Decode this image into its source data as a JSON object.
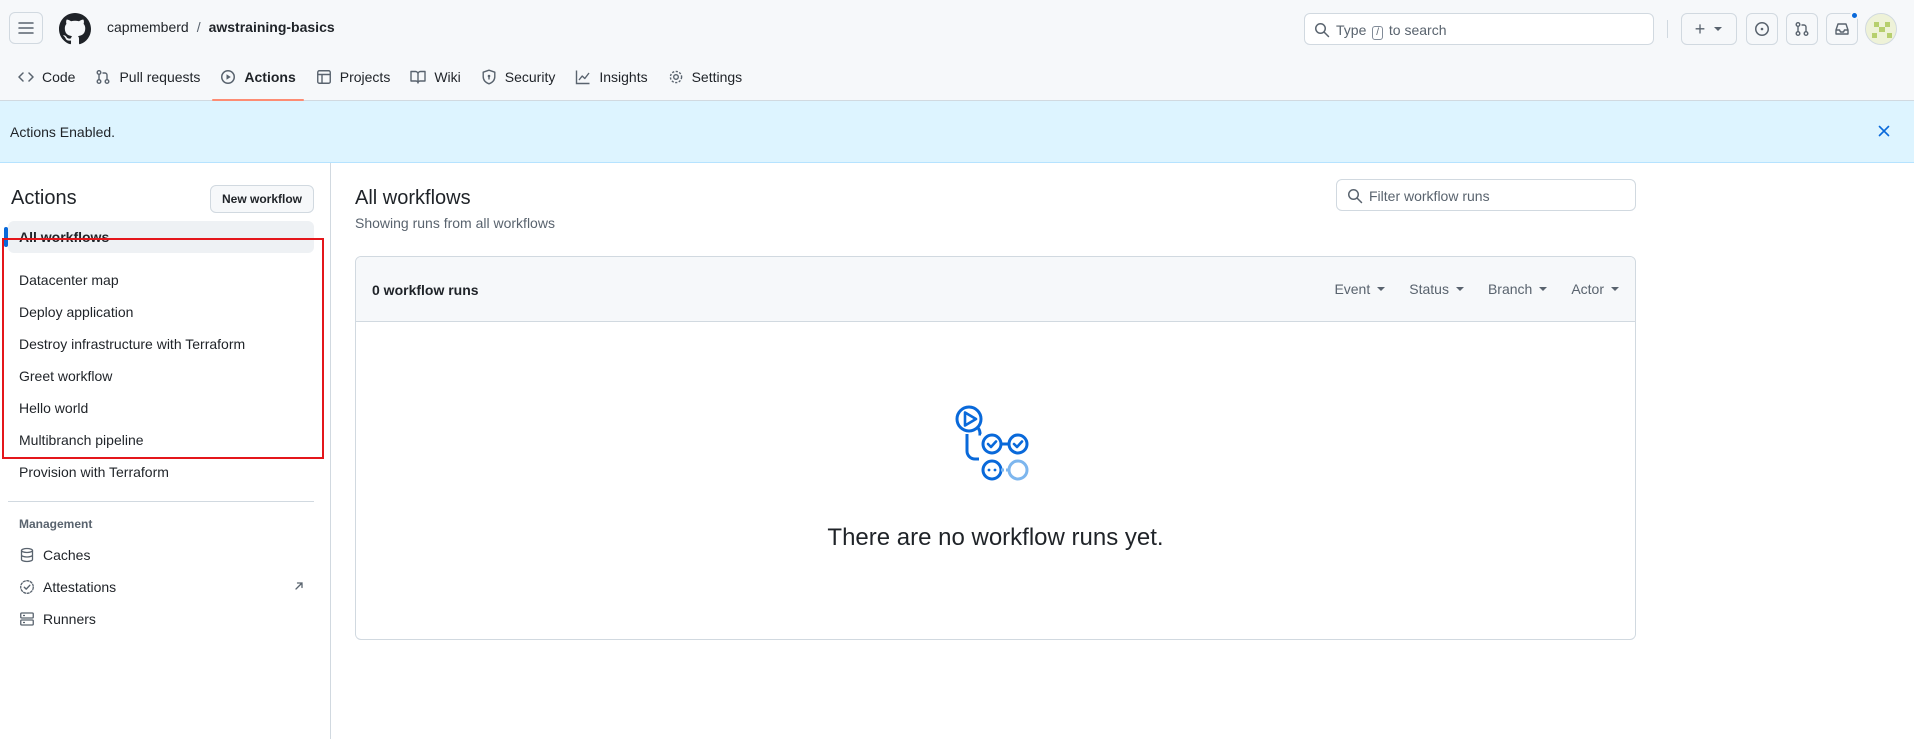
{
  "header": {
    "owner": "capmemberd",
    "separator": "/",
    "repo": "awstraining-basics",
    "search_placeholder_prefix": "Type",
    "search_key": "/",
    "search_placeholder_suffix": "to search",
    "plus_symbol": "+"
  },
  "nav": {
    "tabs": [
      {
        "label": "Code",
        "icon": "code-icon"
      },
      {
        "label": "Pull requests",
        "icon": "pull-request-icon"
      },
      {
        "label": "Actions",
        "icon": "play-icon",
        "selected": true
      },
      {
        "label": "Projects",
        "icon": "table-icon"
      },
      {
        "label": "Wiki",
        "icon": "book-icon"
      },
      {
        "label": "Security",
        "icon": "shield-icon"
      },
      {
        "label": "Insights",
        "icon": "graph-icon"
      },
      {
        "label": "Settings",
        "icon": "gear-icon"
      }
    ]
  },
  "flash": {
    "message": "Actions Enabled."
  },
  "sidebar": {
    "title": "Actions",
    "new_workflow_label": "New workflow",
    "all_workflows_label": "All workflows",
    "workflows": [
      "Datacenter map",
      "Deploy application",
      "Destroy infrastructure with Terraform",
      "Greet workflow",
      "Hello world",
      "Multibranch pipeline",
      "Provision with Terraform"
    ],
    "management_heading": "Management",
    "management_items": [
      {
        "label": "Caches",
        "icon": "database-icon"
      },
      {
        "label": "Attestations",
        "icon": "verified-icon",
        "external": true
      },
      {
        "label": "Runners",
        "icon": "server-icon"
      }
    ]
  },
  "main": {
    "title": "All workflows",
    "subtitle": "Showing runs from all workflows",
    "filter_placeholder": "Filter workflow runs",
    "runs_count": "0 workflow runs",
    "filters": [
      "Event",
      "Status",
      "Branch",
      "Actor"
    ],
    "empty_message": "There are no workflow runs yet."
  },
  "colors": {
    "accent": "#0969da",
    "tab_underline": "#fd8c73",
    "flash_bg": "#ddf4ff",
    "highlight_box": "#e4161b"
  }
}
